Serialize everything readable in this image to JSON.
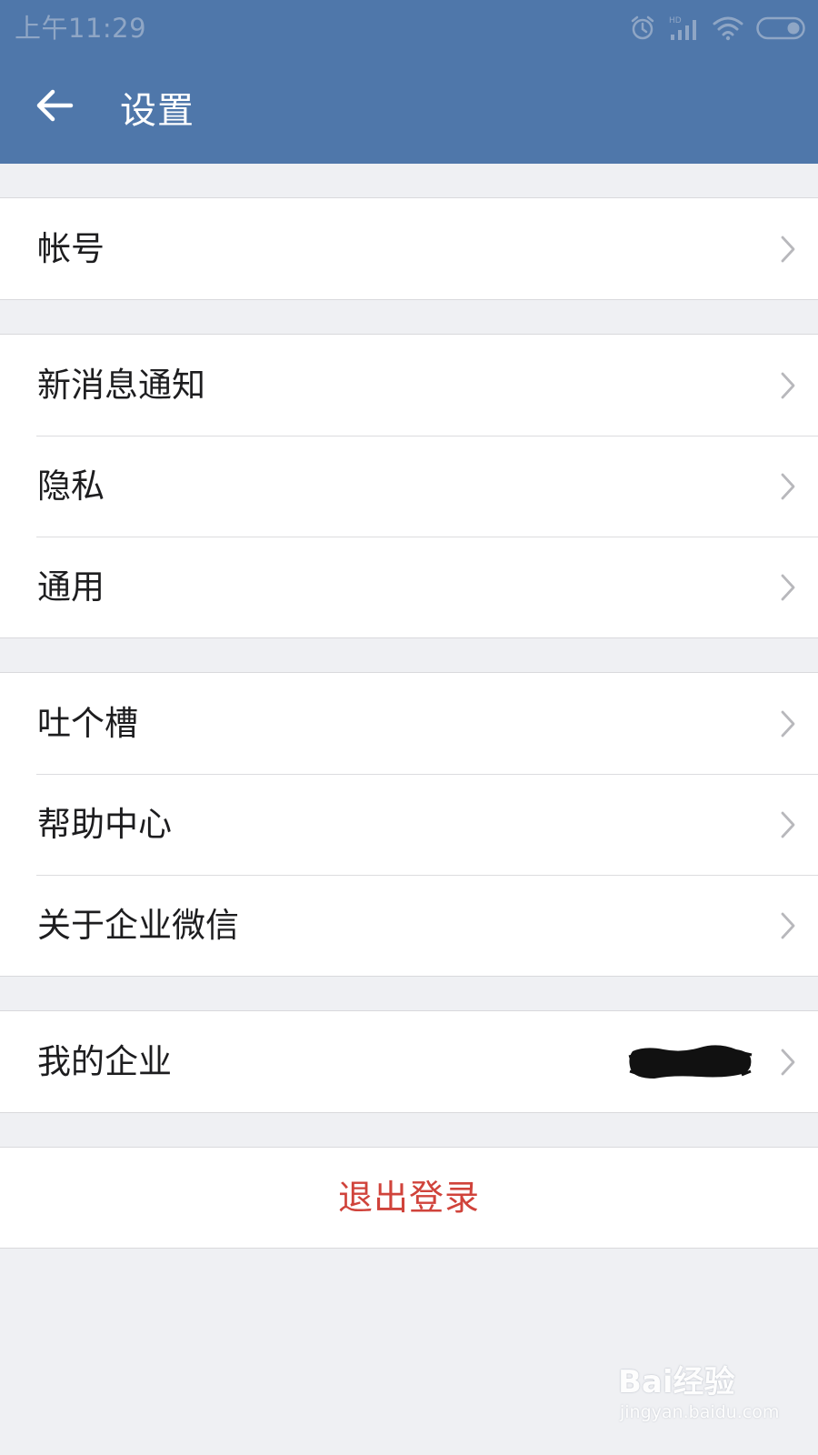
{
  "status_bar": {
    "time": "上午11:29",
    "icons": [
      "alarm-icon",
      "signal-hd-icon",
      "wifi-icon",
      "battery-icon"
    ]
  },
  "header": {
    "title": "设置",
    "back_icon": "arrow-left-icon"
  },
  "groups": [
    {
      "items": [
        {
          "label": "帐号"
        }
      ]
    },
    {
      "items": [
        {
          "label": "新消息通知"
        },
        {
          "label": "隐私"
        },
        {
          "label": "通用"
        }
      ]
    },
    {
      "items": [
        {
          "label": "吐个槽"
        },
        {
          "label": "帮助中心"
        },
        {
          "label": "关于企业微信"
        }
      ]
    },
    {
      "items": [
        {
          "label": "我的企业"
        }
      ]
    }
  ],
  "logout": {
    "label": "退出登录"
  },
  "watermark": {
    "brand": "Bai经验",
    "url": "jingyan.baidu.com"
  },
  "colors": {
    "header_bg": "#4f77aa",
    "page_bg": "#eff0f3",
    "logout_text": "#d0433b"
  }
}
